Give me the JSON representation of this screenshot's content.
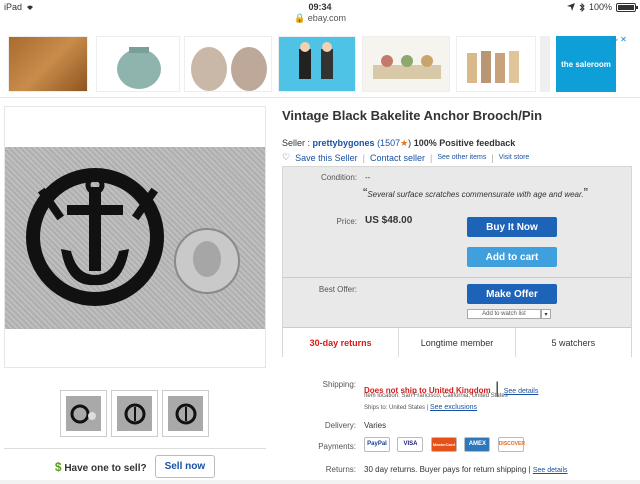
{
  "status_bar": {
    "device": "iPad",
    "time": "09:34",
    "url": "ebay.com",
    "battery": "100%",
    "battery_level": 1.0
  },
  "ad_strip": {
    "ad_text": "the saleroom",
    "ad_choices_icon": "ad-choices-icon",
    "close_icon": "close-icon"
  },
  "item": {
    "title": "Vintage Black Bakelite Anchor Brooch/Pin"
  },
  "seller": {
    "prefix": "Seller :",
    "name": "prettybygones",
    "score_open": "(1507",
    "score_close": ")",
    "star_icon": "star-icon",
    "feedback": "100% Positive feedback",
    "save_label": "Save this Seller",
    "contact_label": "Contact seller",
    "other_items_label": "See other items",
    "store_label": "Visit store",
    "separator": "|"
  },
  "purchase_box": {
    "condition_label": "Condition:",
    "condition_value": "--",
    "condition_quote": "Several surface scratches commensurate with age and wear.",
    "quote_open": "“",
    "quote_close": "”",
    "price_label": "Price:",
    "price_value": "US $48.00",
    "buy_label": "Buy It Now",
    "cart_label": "Add to cart",
    "offer_label": "Best Offer:",
    "offer_button": "Make Offer",
    "watch_label": "Add to watch list",
    "watch_dropdown": "▾",
    "returns_stat": "30-day returns",
    "member_stat": "Longtime member",
    "watchers_stat": "5 watchers"
  },
  "sell": {
    "dollar": "$",
    "question": "Have one to sell?",
    "button": "Sell now"
  },
  "details": {
    "shipping_label": "Shipping:",
    "shipping_value": "Does not ship to United Kingdom",
    "separator": "|",
    "see_details": "See details",
    "location_label": "Item location:",
    "location_value": "San Francisco, California, United States",
    "ships_to_label": "Ships to:",
    "ships_to_value": "United States",
    "see_exclusions": "See exclusions",
    "delivery_label": "Delivery:",
    "delivery_value": "Varies",
    "payments_label": "Payments:",
    "payment_methods": [
      "PayPal",
      "VISA",
      "MasterCard",
      "AMEX",
      "DISCOVER"
    ],
    "returns_label": "Returns:",
    "returns_value": "30 day returns. Buyer pays for return shipping",
    "returns_details": "See details"
  },
  "colors": {
    "primary_button": "#1d63b7",
    "secondary_button": "#40a0de",
    "link": "#1a52a3",
    "alert": "#d61a1a"
  }
}
